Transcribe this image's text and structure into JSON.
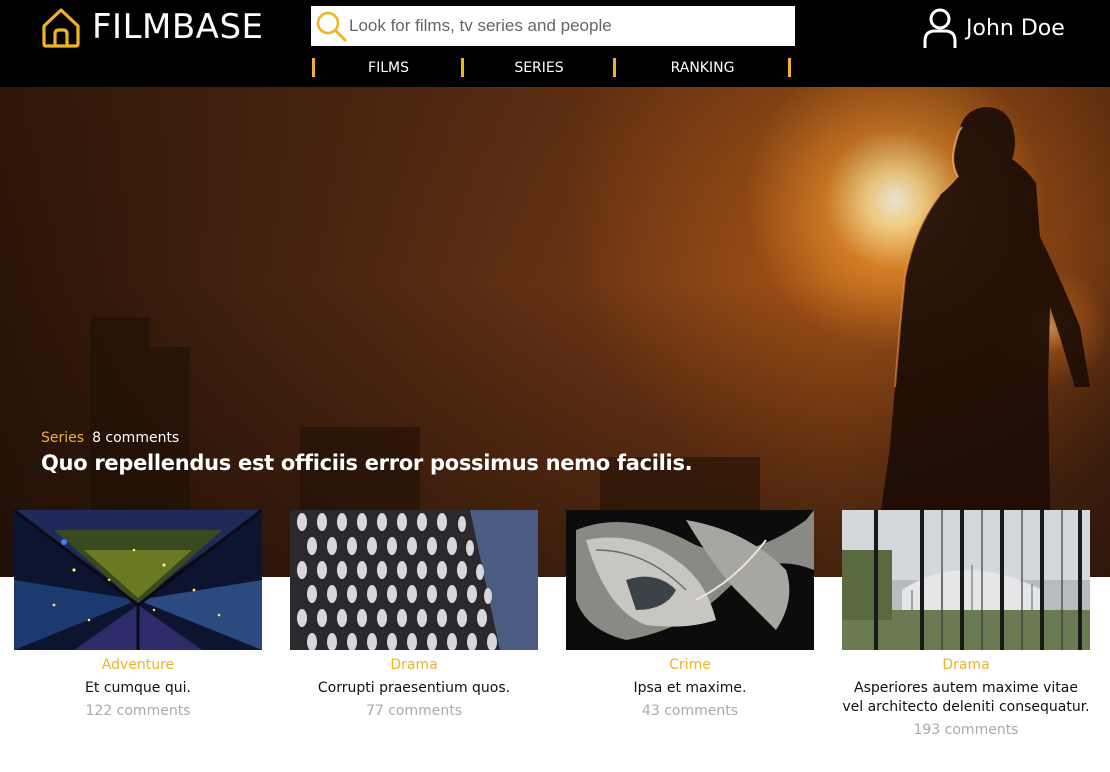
{
  "header": {
    "brand": "FILMBASE",
    "logo_icon": "home-icon",
    "search": {
      "placeholder": "Look for films, tv series and people",
      "value": "",
      "icon": "search-icon"
    },
    "nav": [
      {
        "label": "FILMS"
      },
      {
        "label": "SERIES"
      },
      {
        "label": "RANKING"
      }
    ],
    "user": {
      "name": "John Doe",
      "icon": "user-icon"
    }
  },
  "colors": {
    "accent": "#f0b323",
    "header_bg": "#000000",
    "muted_text": "#aaaaaa"
  },
  "hero": {
    "category": "Series",
    "comments": "8 comments",
    "title": "Quo repellendus est officiis error possimus nemo facilis."
  },
  "cards": [
    {
      "category": "Adventure",
      "title": "Et cumque qui.",
      "comments": "122 comments"
    },
    {
      "category": "Drama",
      "title": "Corrupti praesentium quos.",
      "comments": "77 comments"
    },
    {
      "category": "Crime",
      "title": "Ipsa et maxime.",
      "comments": "43 comments"
    },
    {
      "category": "Drama",
      "title": "Asperiores autem maxime vitae vel architecto deleniti consequatur.",
      "comments": "193 comments"
    }
  ]
}
